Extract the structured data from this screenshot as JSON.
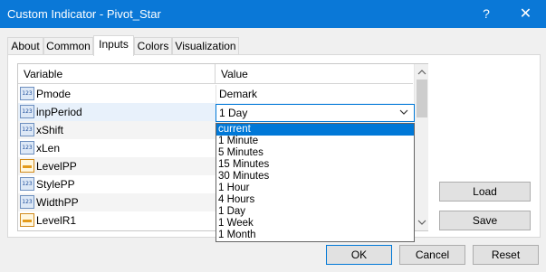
{
  "window": {
    "title": "Custom Indicator - Pivot_Star",
    "help": "?",
    "close": "✕"
  },
  "tabs": [
    {
      "label": "About"
    },
    {
      "label": "Common"
    },
    {
      "label": "Inputs"
    },
    {
      "label": "Colors"
    },
    {
      "label": "Visualization"
    }
  ],
  "grid": {
    "col_variable": "Variable",
    "col_value": "Value",
    "rows": [
      {
        "name": "Pmode",
        "value": "Demark",
        "icon": "numeric-icon"
      },
      {
        "name": "inpPeriod",
        "value": "1 Day",
        "icon": "numeric-icon"
      },
      {
        "name": "xShift",
        "value": "",
        "icon": "numeric-icon"
      },
      {
        "name": "xLen",
        "value": "",
        "icon": "numeric-icon"
      },
      {
        "name": "LevelPP",
        "value": "",
        "icon": "level-icon"
      },
      {
        "name": "StylePP",
        "value": "",
        "icon": "numeric-icon"
      },
      {
        "name": "WidthPP",
        "value": "",
        "icon": "numeric-icon"
      },
      {
        "name": "LevelR1",
        "value": "",
        "icon": "level-icon"
      }
    ]
  },
  "dropdown": {
    "selected": "1 Day",
    "options": [
      "current",
      "1 Minute",
      "5 Minutes",
      "15 Minutes",
      "30 Minutes",
      "1 Hour",
      "4 Hours",
      "1 Day",
      "1 Week",
      "1 Month"
    ],
    "highlighted": "current"
  },
  "buttons": {
    "load": "Load",
    "save": "Save",
    "ok": "OK",
    "cancel": "Cancel",
    "reset": "Reset"
  },
  "colors": {
    "titlebar": "#0a78d7",
    "accent": "#0078d7"
  }
}
